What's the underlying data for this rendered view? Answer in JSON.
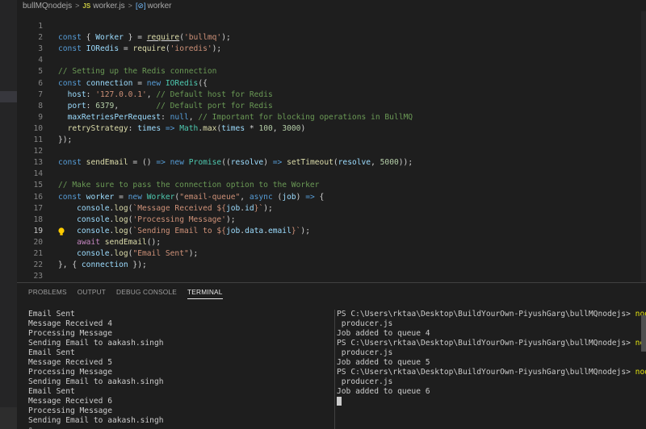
{
  "breadcrumb": {
    "folder": "bullMQnodejs",
    "file": "worker.js",
    "symbol": "worker",
    "file_icon": "JS"
  },
  "editor": {
    "current_line": 19,
    "lines": [
      {
        "n": "1",
        "tokens": []
      },
      {
        "n": "2",
        "tokens": [
          [
            "kw",
            "const"
          ],
          [
            "pun",
            " { "
          ],
          [
            "var",
            "Worker"
          ],
          [
            "pun",
            " } = "
          ],
          [
            "fn",
            "require",
            "und"
          ],
          [
            "pun",
            "("
          ],
          [
            "str",
            "'bullmq'"
          ],
          [
            "pun",
            ");"
          ]
        ]
      },
      {
        "n": "3",
        "tokens": [
          [
            "kw",
            "const"
          ],
          [
            "pun",
            " "
          ],
          [
            "var",
            "IORedis"
          ],
          [
            "pun",
            " = "
          ],
          [
            "fn",
            "require"
          ],
          [
            "pun",
            "("
          ],
          [
            "str",
            "'ioredis'"
          ],
          [
            "pun",
            ");"
          ]
        ]
      },
      {
        "n": "4",
        "tokens": []
      },
      {
        "n": "5",
        "tokens": [
          [
            "cmt",
            "// Setting up the Redis connection"
          ]
        ]
      },
      {
        "n": "6",
        "tokens": [
          [
            "kw",
            "const"
          ],
          [
            "pun",
            " "
          ],
          [
            "var",
            "connection"
          ],
          [
            "pun",
            " = "
          ],
          [
            "kw",
            "new"
          ],
          [
            "pun",
            " "
          ],
          [
            "cls",
            "IORedis"
          ],
          [
            "pun",
            "({"
          ]
        ]
      },
      {
        "n": "7",
        "tokens": [
          [
            "pun",
            "  "
          ],
          [
            "var",
            "host"
          ],
          [
            "pun",
            ": "
          ],
          [
            "str",
            "'127.0.0.1'"
          ],
          [
            "pun",
            ", "
          ],
          [
            "cmt",
            "// Default host for Redis"
          ]
        ]
      },
      {
        "n": "8",
        "tokens": [
          [
            "pun",
            "  "
          ],
          [
            "var",
            "port"
          ],
          [
            "pun",
            ": "
          ],
          [
            "num",
            "6379"
          ],
          [
            "pun",
            ",        "
          ],
          [
            "cmt",
            "// Default port for Redis"
          ]
        ]
      },
      {
        "n": "9",
        "tokens": [
          [
            "pun",
            "  "
          ],
          [
            "var",
            "maxRetriesPerRequest"
          ],
          [
            "pun",
            ": "
          ],
          [
            "kw",
            "null"
          ],
          [
            "pun",
            ", "
          ],
          [
            "cmt",
            "// Important for blocking operations in BullMQ"
          ]
        ]
      },
      {
        "n": "10",
        "tokens": [
          [
            "pun",
            "  "
          ],
          [
            "fn",
            "retryStrategy"
          ],
          [
            "pun",
            ": "
          ],
          [
            "var",
            "times"
          ],
          [
            "pun",
            " "
          ],
          [
            "kw",
            "=>"
          ],
          [
            "pun",
            " "
          ],
          [
            "cls",
            "Math"
          ],
          [
            "pun",
            "."
          ],
          [
            "fn",
            "max"
          ],
          [
            "pun",
            "("
          ],
          [
            "var",
            "times"
          ],
          [
            "pun",
            " * "
          ],
          [
            "num",
            "100"
          ],
          [
            "pun",
            ", "
          ],
          [
            "num",
            "3000"
          ],
          [
            "pun",
            ")"
          ]
        ]
      },
      {
        "n": "11",
        "tokens": [
          [
            "pun",
            "});"
          ]
        ]
      },
      {
        "n": "12",
        "tokens": []
      },
      {
        "n": "13",
        "tokens": [
          [
            "kw",
            "const"
          ],
          [
            "pun",
            " "
          ],
          [
            "fn",
            "sendEmail"
          ],
          [
            "pun",
            " = () "
          ],
          [
            "kw",
            "=>"
          ],
          [
            "pun",
            " "
          ],
          [
            "kw",
            "new"
          ],
          [
            "pun",
            " "
          ],
          [
            "cls",
            "Promise"
          ],
          [
            "pun",
            "(("
          ],
          [
            "var",
            "resolve"
          ],
          [
            "pun",
            ") "
          ],
          [
            "kw",
            "=>"
          ],
          [
            "pun",
            " "
          ],
          [
            "fn",
            "setTimeout"
          ],
          [
            "pun",
            "("
          ],
          [
            "var",
            "resolve"
          ],
          [
            "pun",
            ", "
          ],
          [
            "num",
            "5000"
          ],
          [
            "pun",
            "));"
          ]
        ]
      },
      {
        "n": "14",
        "tokens": []
      },
      {
        "n": "15",
        "tokens": [
          [
            "cmt",
            "// Make sure to pass the connection option to the Worker"
          ]
        ]
      },
      {
        "n": "16",
        "tokens": [
          [
            "kw",
            "const"
          ],
          [
            "pun",
            " "
          ],
          [
            "var",
            "worker"
          ],
          [
            "pun",
            " = "
          ],
          [
            "kw",
            "new"
          ],
          [
            "pun",
            " "
          ],
          [
            "cls",
            "Worker"
          ],
          [
            "pun",
            "("
          ],
          [
            "str",
            "\"email-queue\""
          ],
          [
            "pun",
            ", "
          ],
          [
            "kw",
            "async"
          ],
          [
            "pun",
            " ("
          ],
          [
            "var",
            "job"
          ],
          [
            "pun",
            ") "
          ],
          [
            "kw",
            "=>"
          ],
          [
            "pun",
            " {"
          ]
        ]
      },
      {
        "n": "17",
        "tokens": [
          [
            "pun",
            "    "
          ],
          [
            "var",
            "console"
          ],
          [
            "pun",
            "."
          ],
          [
            "fn",
            "log"
          ],
          [
            "pun",
            "("
          ],
          [
            "str",
            "`Message Received ${"
          ],
          [
            "var",
            "job"
          ],
          [
            "pun",
            "."
          ],
          [
            "var",
            "id"
          ],
          [
            "str",
            "}`"
          ],
          [
            "pun",
            ");"
          ]
        ]
      },
      {
        "n": "18",
        "tokens": [
          [
            "pun",
            "    "
          ],
          [
            "var",
            "console"
          ],
          [
            "pun",
            "."
          ],
          [
            "fn",
            "log"
          ],
          [
            "pun",
            "("
          ],
          [
            "str",
            "'Processing Message'"
          ],
          [
            "pun",
            ");"
          ]
        ]
      },
      {
        "n": "19",
        "tokens": [
          [
            "pun",
            "    "
          ],
          [
            "var",
            "console"
          ],
          [
            "pun",
            "."
          ],
          [
            "fn",
            "log"
          ],
          [
            "pun",
            "("
          ],
          [
            "str",
            "`Sending Email to ${"
          ],
          [
            "var",
            "job"
          ],
          [
            "pun",
            "."
          ],
          [
            "var",
            "data"
          ],
          [
            "pun",
            "."
          ],
          [
            "var",
            "email"
          ],
          [
            "str",
            "}`"
          ],
          [
            "pun",
            ");"
          ]
        ]
      },
      {
        "n": "20",
        "tokens": [
          [
            "pun",
            "    "
          ],
          [
            "ctl",
            "await"
          ],
          [
            "pun",
            " "
          ],
          [
            "fn",
            "sendEmail"
          ],
          [
            "pun",
            "();"
          ]
        ]
      },
      {
        "n": "21",
        "tokens": [
          [
            "pun",
            "    "
          ],
          [
            "var",
            "console"
          ],
          [
            "pun",
            "."
          ],
          [
            "fn",
            "log"
          ],
          [
            "pun",
            "("
          ],
          [
            "str",
            "\"Email Sent\""
          ],
          [
            "pun",
            ");"
          ]
        ]
      },
      {
        "n": "22",
        "tokens": [
          [
            "pun",
            "}, { "
          ],
          [
            "var",
            "connection"
          ],
          [
            "pun",
            " });"
          ]
        ]
      },
      {
        "n": "23",
        "tokens": []
      }
    ]
  },
  "panel": {
    "tabs": [
      {
        "label": "PROBLEMS",
        "active": false
      },
      {
        "label": "OUTPUT",
        "active": false
      },
      {
        "label": "DEBUG CONSOLE",
        "active": false
      },
      {
        "label": "TERMINAL",
        "active": true
      }
    ],
    "left_terminal": [
      "Email Sent",
      "Message Received 4",
      "Processing Message",
      "Sending Email to aakash.singh",
      "Email Sent",
      "Message Received 5",
      "Processing Message",
      "Sending Email to aakash.singh",
      "Email Sent",
      "Message Received 6",
      "Processing Message",
      "Sending Email to aakash.singh",
      "▯"
    ],
    "right_terminal": [
      {
        "prompt": "PS C:\\Users\\rktaa\\Desktop\\BuildYourOwn-PiyushGarg\\bullMQnodejs> ",
        "cmd": "node"
      },
      {
        "text": " producer.js"
      },
      {
        "text": "Job added to queue 4"
      },
      {
        "prompt": "PS C:\\Users\\rktaa\\Desktop\\BuildYourOwn-PiyushGarg\\bullMQnodejs> ",
        "cmd": "node"
      },
      {
        "text": " producer.js"
      },
      {
        "text": "Job added to queue 5"
      },
      {
        "prompt": "PS C:\\Users\\rktaa\\Desktop\\BuildYourOwn-PiyushGarg\\bullMQnodejs> ",
        "cmd": "node"
      },
      {
        "text": " producer.js"
      },
      {
        "text": "Job added to queue 6"
      },
      {
        "cursor": true
      }
    ]
  }
}
